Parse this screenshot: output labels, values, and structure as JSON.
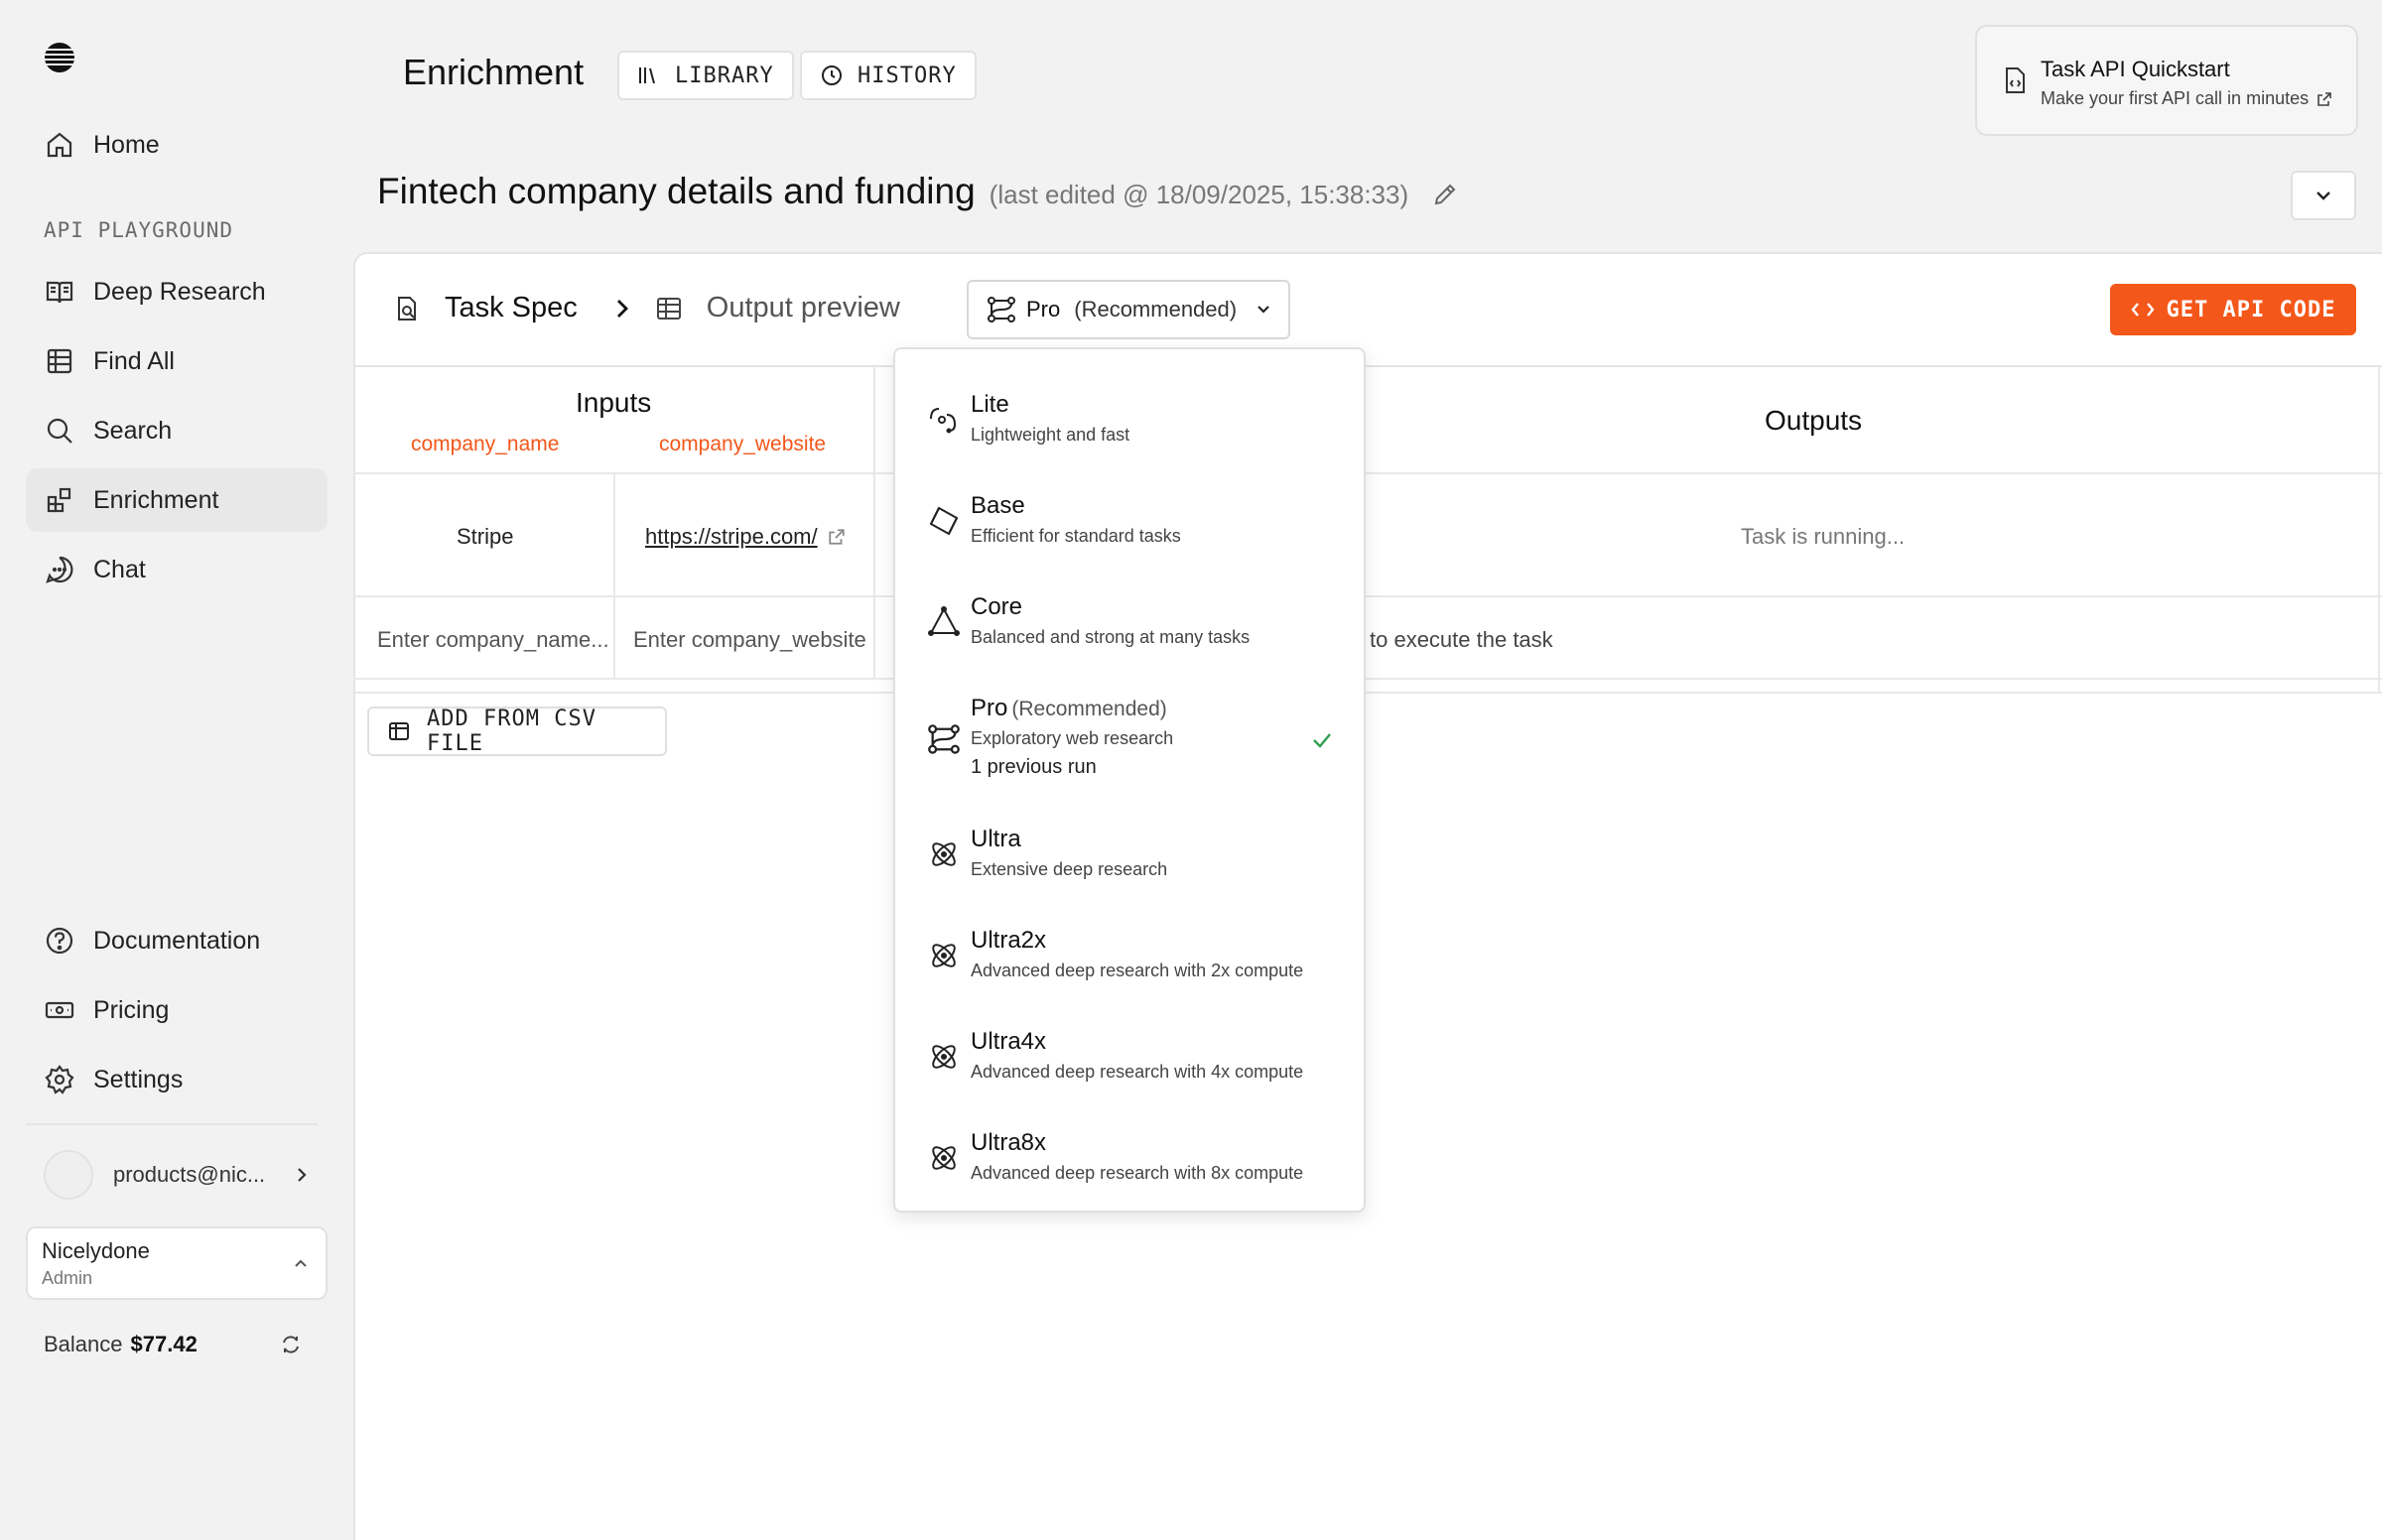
{
  "sidebar": {
    "nav_top": [
      {
        "label": "Home",
        "icon": "home-icon"
      }
    ],
    "section_label": "API PLAYGROUND",
    "nav_playground": [
      {
        "label": "Deep Research",
        "icon": "book-icon"
      },
      {
        "label": "Find All",
        "icon": "grid-icon"
      },
      {
        "label": "Search",
        "icon": "search-icon"
      },
      {
        "label": "Enrichment",
        "icon": "blocks-icon",
        "active": true
      },
      {
        "label": "Chat",
        "icon": "chat-icon"
      }
    ],
    "nav_bottom": [
      {
        "label": "Documentation",
        "icon": "help-icon"
      },
      {
        "label": "Pricing",
        "icon": "money-icon"
      },
      {
        "label": "Settings",
        "icon": "gear-icon"
      }
    ],
    "user_email": "products@nic...",
    "org": {
      "name": "Nicelydone",
      "role": "Admin"
    },
    "balance": {
      "label": "Balance",
      "value": "$77.42"
    }
  },
  "header": {
    "title": "Enrichment",
    "library_label": "LIBRARY",
    "history_label": "HISTORY",
    "quickstart": {
      "title": "Task API Quickstart",
      "subtitle": "Make your first API call in minutes"
    }
  },
  "task": {
    "title": "Fintech company details and funding",
    "last_edited": "(last edited @ 18/09/2025, 15:38:33)"
  },
  "toolbar": {
    "task_spec": "Task Spec",
    "output_preview": "Output preview",
    "model_name": "Pro",
    "model_tag": "(Recommended)",
    "api_code": "GET API CODE"
  },
  "table": {
    "inputs_header": "Inputs",
    "outputs_header": "Outputs",
    "columns": [
      "company_name",
      "company_website"
    ],
    "rows": [
      {
        "company_name": "Stripe",
        "company_website": "https://stripe.com/",
        "output": "Task is running..."
      }
    ],
    "empty_row": {
      "company_name_placeholder": "Enter company_name...",
      "company_website_placeholder": "Enter company_website",
      "output_hint": "to execute the task"
    },
    "csv_button": "ADD FROM CSV FILE"
  },
  "model_dropdown": {
    "options": [
      {
        "name": "Lite",
        "description": "Lightweight and fast",
        "icon": "lite-icon"
      },
      {
        "name": "Base",
        "description": "Efficient for standard tasks",
        "icon": "base-icon"
      },
      {
        "name": "Core",
        "description": "Balanced and strong at many tasks",
        "icon": "core-icon"
      },
      {
        "name": "Pro",
        "tag": "(Recommended)",
        "description": "Exploratory web research",
        "runs": "1 previous run",
        "icon": "pro-icon",
        "selected": true
      },
      {
        "name": "Ultra",
        "description": "Extensive deep research",
        "icon": "ultra-icon"
      },
      {
        "name": "Ultra2x",
        "description": "Advanced deep research with 2x compute",
        "icon": "ultra-icon"
      },
      {
        "name": "Ultra4x",
        "description": "Advanced deep research with 4x compute",
        "icon": "ultra-icon"
      },
      {
        "name": "Ultra8x",
        "description": "Advanced deep research with 8x compute",
        "icon": "ultra-icon"
      }
    ]
  },
  "colors": {
    "accent": "#f4571a",
    "check": "#2e9e4f"
  }
}
